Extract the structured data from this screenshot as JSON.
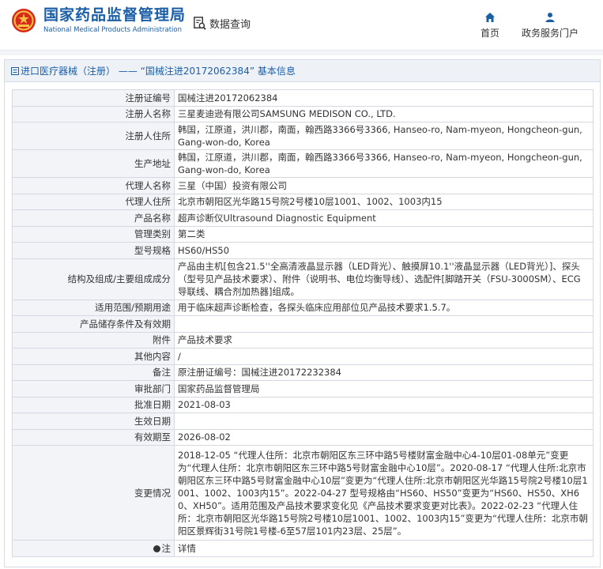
{
  "header": {
    "org_cn": "国家药品监督管理局",
    "org_en": "National Medical Products Administration",
    "query_label": "数据查询",
    "nav": [
      {
        "label": "首页",
        "icon": "home-icon"
      },
      {
        "label": "政务服务门户",
        "icon": "user-icon"
      }
    ]
  },
  "panel": {
    "title": "进口医疗器械（注册） —— “国械注进20172062384” 基本信息"
  },
  "rows": [
    {
      "label": "注册证编号",
      "value": "国械注进20172062384"
    },
    {
      "label": "注册人名称",
      "value": "三星麦迪逊有限公司SAMSUNG MEDISON CO., LTD."
    },
    {
      "label": "注册人住所",
      "value": "韩国，江原道，洪川郡，南面，翰西路3366号3366, Hanseo-ro, Nam-myeon, Hongcheon-gun, Gang-won-do, Korea"
    },
    {
      "label": "生产地址",
      "value": "韩国，江原道，洪川郡，南面，翰西路3366号3366, Hanseo-ro, Nam-myeon, Hongcheon-gun, Gang-won-do, Korea"
    },
    {
      "label": "代理人名称",
      "value": "三星（中国）投资有限公司"
    },
    {
      "label": "代理人住所",
      "value": "北京市朝阳区光华路15号院2号楼10层1001、1002、1003内15"
    },
    {
      "label": "产品名称",
      "value": "超声诊断仪Ultrasound Diagnostic Equipment"
    },
    {
      "label": "管理类别",
      "value": "第二类"
    },
    {
      "label": "型号规格",
      "value": "HS60/HS50"
    },
    {
      "label": "结构及组成/主要组成成分",
      "value": "产品由主机[包含21.5''全高清液晶显示器（LED背光）、触摸屏10.1''液晶显示器（LED背光）]、探头（型号见产品技术要求）、附件（说明书、电位均衡导线）、选配件[脚踏开关（FSU-3000SM）、ECG导联线、耦合剂加热器]组成。"
    },
    {
      "label": "适用范围/预期用途",
      "value": "用于临床超声诊断检查，各探头临床应用部位见产品技术要求1.5.7。"
    },
    {
      "label": "产品储存条件及有效期",
      "value": ""
    },
    {
      "label": "附件",
      "value": "产品技术要求"
    },
    {
      "label": "其他内容",
      "value": "/"
    },
    {
      "label": "备注",
      "value": "原注册证编号：国械注进20172232384"
    },
    {
      "label": "审批部门",
      "value": "国家药品监督管理局"
    },
    {
      "label": "批准日期",
      "value": "2021-08-03"
    },
    {
      "label": "生效日期",
      "value": ""
    },
    {
      "label": "有效期至",
      "value": "2026-08-02"
    },
    {
      "label": "变更情况",
      "value": "2018-12-05 “代理人住所：北京市朝阳区东三环中路5号楼财富金融中心4-10层01-08单元”变更为“代理人住所：北京市朝阳区东三环中路5号财富金融中心10层”。2020-08-17 “代理人住所:北京市朝阳区东三环中路5号财富金融中心10层”变更为“代理人住所:北京市朝阳区光华路15号院2号楼10层1001、1002、1003内15”。2022-04-27 型号规格由“HS60、HS50”变更为“HS60、HS50、XH60、XH50”。适用范围及产品技术要求变化见《产品技术要求变更对比表》。2022-02-23 “代理人住所：北京市朝阳区光华路15号院2号楼10层1001、1002、1003内15”变更为“代理人住所：北京市朝阳区景辉街31号院1号楼-6至57层101内23层、25层”。"
    },
    {
      "label": "注",
      "value": "详情"
    }
  ],
  "colors": {
    "brand": "#1b5ea8",
    "label_bg": "#f2f4f7",
    "border": "#d4d9e1"
  }
}
